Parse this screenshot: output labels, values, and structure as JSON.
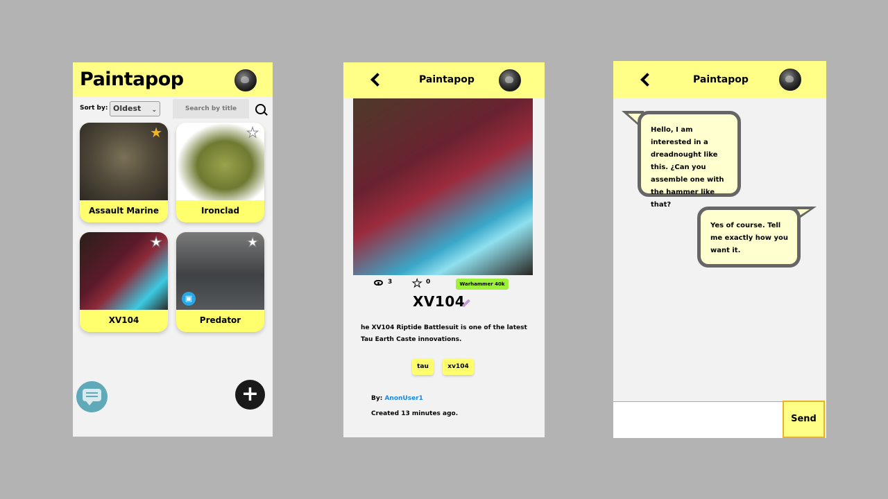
{
  "list_screen": {
    "title": "Paintapop",
    "sort_label": "Sort by:",
    "sort_value": "Oldest",
    "search_placeholder": "Search by title",
    "cards": [
      {
        "label": "Assault Marine",
        "starred": true
      },
      {
        "label": "Ironclad",
        "starred": false
      },
      {
        "label": "XV104",
        "starred": false
      },
      {
        "label": "Predator",
        "starred": false
      }
    ]
  },
  "detail_screen": {
    "title": "Paintapop",
    "views": "3",
    "stars": "0",
    "game_tag": "Warhammer 40k",
    "model_title": "XV104",
    "description": "he XV104 Riptide Battlesuit is one of the latest Tau Earth Caste innovations.",
    "tags": [
      "tau",
      "xv104"
    ],
    "by_label": "By:",
    "author": "AnonUser1",
    "created": "Created 13 minutes ago."
  },
  "chat_screen": {
    "title": "Paintapop",
    "messages": [
      "Hello, I am interested in a dreadnought like this. ¿Can you assemble one with the hammer like that?",
      "Yes of course. Tell me exactly how you want it."
    ],
    "send_label": "Send"
  },
  "colors": {
    "header": "#ffff88",
    "card": "#ffff6e",
    "page_bg": "#b3b3b3",
    "link": "#1e88e5",
    "game_tag": "#9ef03a"
  }
}
